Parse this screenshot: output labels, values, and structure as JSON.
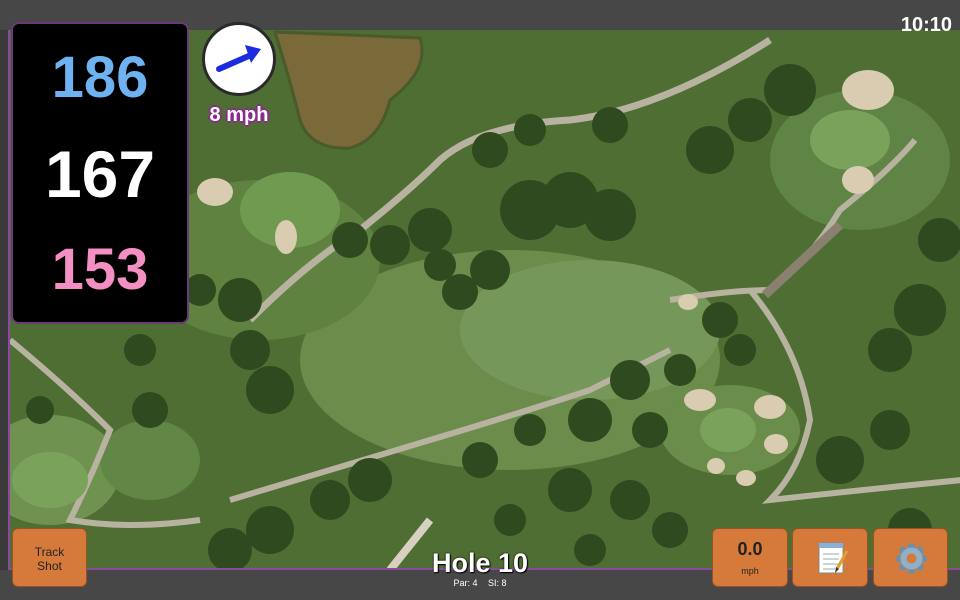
{
  "clock": "10:10",
  "distances": {
    "back": "186",
    "middle": "167",
    "front": "153"
  },
  "wind": {
    "speed_label": "8 mph"
  },
  "hole": {
    "title": "Hole 10",
    "par_label": "Par: 4",
    "si_label": "SI: 8"
  },
  "buttons": {
    "track_shot": "Track Shot",
    "speed_value": "0.0",
    "speed_unit": "mph"
  },
  "icons": {
    "wind_arrow": "wind-direction-arrow",
    "notes": "notepad-icon",
    "settings": "gear-icon"
  },
  "colors": {
    "back": "#6fb2f2",
    "middle": "#ffffff",
    "front": "#f48fc4",
    "accent": "#d67a3c"
  }
}
